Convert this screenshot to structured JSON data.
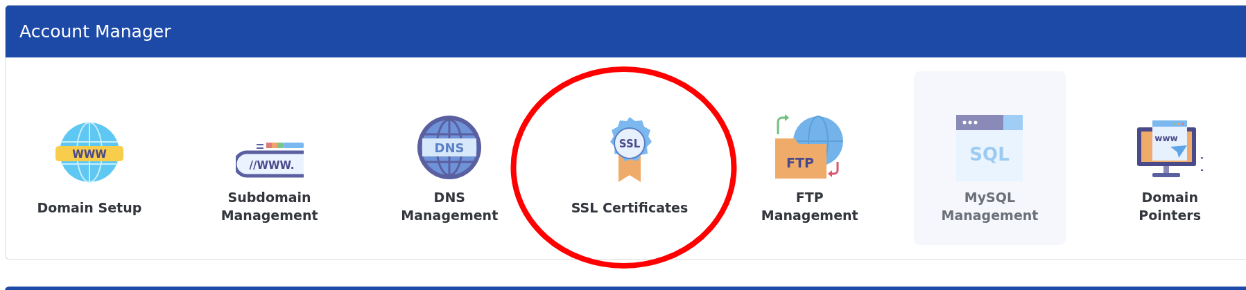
{
  "panel": {
    "title": "Account Manager"
  },
  "items": [
    {
      "label": "Domain Setup",
      "kind": "globe",
      "icon_text": "WWW",
      "highlighted": false,
      "circled": false
    },
    {
      "label": "Subdomain\nManagement",
      "kind": "subdomain",
      "icon_text": "//WWW.",
      "highlighted": false,
      "circled": false
    },
    {
      "label": "DNS\nManagement",
      "kind": "dns",
      "icon_text": "DNS",
      "highlighted": false,
      "circled": false
    },
    {
      "label": "SSL Certificates",
      "kind": "ssl",
      "icon_text": "SSL",
      "highlighted": false,
      "circled": true
    },
    {
      "label": "FTP\nManagement",
      "kind": "ftp",
      "icon_text": "FTP",
      "highlighted": false,
      "circled": false
    },
    {
      "label": "MySQL\nManagement",
      "kind": "sql",
      "icon_text": "SQL",
      "highlighted": true,
      "circled": false
    },
    {
      "label": "Domain\nPointers",
      "kind": "pointer",
      "icon_text": "www",
      "highlighted": false,
      "circled": false
    }
  ]
}
